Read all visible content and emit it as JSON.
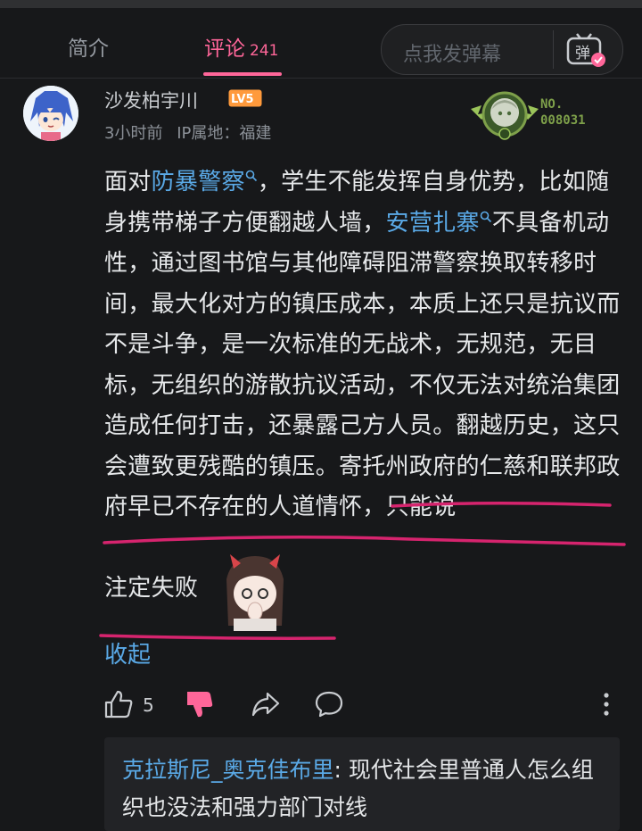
{
  "tabs": {
    "intro": "简介",
    "comments": "评论",
    "comments_count": "241"
  },
  "danmaku": {
    "placeholder": "点我发弹幕",
    "icon_label": "弹"
  },
  "comment": {
    "username": "沙发柏宇川",
    "level": "LV5",
    "time": "3小时前",
    "ip": "IP属地：福建",
    "medal_no": "NO.",
    "medal_id": "008031",
    "text": {
      "p1": "面对",
      "link1": "防暴警察",
      "p2": "，学生不能发挥自身优势，比如随身携带梯子方便翻越人墙，",
      "link2": "安营扎寨",
      "p3": "不具备机动性，通过图书馆与其他障碍阻滞警察换取转移时间，最大化对方的镇压成本，本质上还只是抗议而不是斗争，是一次标准的无战术，无规范，无目标，无组织的游散抗议活动，不仅无法对统治集团造成任何打击，还暴露己方人员。翻越历史，这只会遭致更残酷的镇压。寄托州政府的仁慈和联邦政府早已不存在的人道情怀，只能说",
      "p4": "注定失败"
    },
    "collapse": "收起",
    "likes": "5"
  },
  "reply": {
    "name": "克拉斯尼_奥克佳布里",
    "text": ": 现代社会里普通人怎么组织也没法和强力部门对线"
  },
  "colors": {
    "background": "#17181a",
    "accent": "#ff6699",
    "link": "#5aa9e6",
    "annotation": "#d6246e",
    "medal": "#7ea04a"
  },
  "icons": [
    "magnifier-icon",
    "like-icon",
    "dislike-icon",
    "share-icon",
    "comment-icon",
    "more-icon",
    "danmaku-icon"
  ]
}
